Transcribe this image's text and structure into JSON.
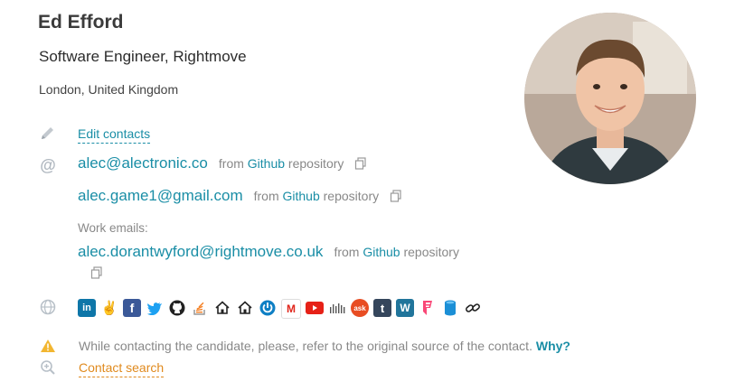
{
  "profile": {
    "name": "Ed Efford",
    "title": "Software Engineer, Rightmove",
    "location": "London, United Kingdom"
  },
  "contacts": {
    "edit_label": "Edit contacts",
    "emails": [
      {
        "address": "alec@alectronic.co",
        "from": "from",
        "source": "Github",
        "suffix": "repository"
      },
      {
        "address": "alec.game1@gmail.com",
        "from": "from",
        "source": "Github",
        "suffix": "repository"
      }
    ],
    "work_label": "Work emails:",
    "work_emails": [
      {
        "address": "alec.dorantwyford@rightmove.co.uk",
        "from": "from",
        "source": "Github",
        "suffix": "repository"
      }
    ]
  },
  "social_icons": [
    "linkedin-icon",
    "angellist-icon",
    "facebook-icon",
    "twitter-icon",
    "github-icon",
    "stackoverflow-icon",
    "home-icon",
    "home-icon",
    "power-icon",
    "medium-icon",
    "youtube-icon",
    "soundcloud-icon",
    "askfm-icon",
    "tumblr-icon",
    "wordpress-icon",
    "foursquare-icon",
    "database-icon",
    "link-icon"
  ],
  "warning": {
    "text": "While contacting the candidate, please, refer to the original source of the contact.",
    "why": "Why?"
  },
  "contact_search_label": "Contact search",
  "colors": {
    "accent": "#1a8ea6",
    "orange": "#e08a1e",
    "warning": "#f2b631"
  }
}
